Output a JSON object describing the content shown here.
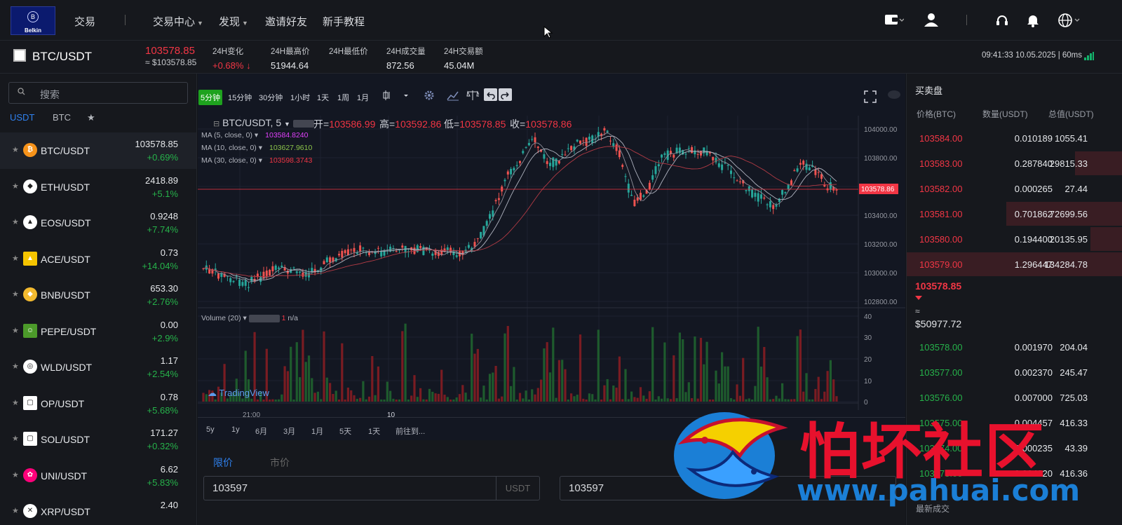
{
  "nav": {
    "logo_text": "Belkin",
    "trade": "交易",
    "items": [
      {
        "label": "交易中心",
        "dropdown": true
      },
      {
        "label": "发现",
        "dropdown": true
      },
      {
        "label": "邀请好友",
        "dropdown": false
      },
      {
        "label": "新手教程",
        "dropdown": false
      }
    ],
    "icons": [
      "wallet-icon",
      "user-icon",
      "headset-icon",
      "bell-icon",
      "globe-icon"
    ]
  },
  "ticker": {
    "pair": "BTC/USDT",
    "last": "103578.85",
    "last_usd": "≈ $103578.85",
    "change_label": "24H变化",
    "change": "+0.68% ↓",
    "high_label": "24H最高价",
    "high": "51944.64",
    "low_label": "24H最低价",
    "low": "",
    "vol_label": "24H成交量",
    "vol": "872.56",
    "amount_label": "24H交易额",
    "amount": "45.04M",
    "clock": "09:41:33 10.05.2025 | 60ms"
  },
  "market": {
    "search_placeholder": "搜索",
    "tabs": [
      "USDT",
      "BTC",
      "★"
    ],
    "rows": [
      {
        "pair": "BTC/USDT",
        "price": "103578.85",
        "change": "+0.69%",
        "icon": "btc-icon",
        "color": "#f7931a",
        "glyph": "₿"
      },
      {
        "pair": "ETH/USDT",
        "price": "2418.89",
        "change": "+5.1%",
        "icon": "eth-icon",
        "color": "#ffffff",
        "glyph": "◆"
      },
      {
        "pair": "EOS/USDT",
        "price": "0.9248",
        "change": "+7.74%",
        "icon": "eos-icon",
        "color": "#ffffff",
        "glyph": "▲"
      },
      {
        "pair": "ACE/USDT",
        "price": "0.73",
        "change": "+14.04%",
        "icon": "ace-icon",
        "color": "#f5c400",
        "glyph": "▲"
      },
      {
        "pair": "BNB/USDT",
        "price": "653.30",
        "change": "+2.76%",
        "icon": "bnb-icon",
        "color": "#f3ba2f",
        "glyph": "◆"
      },
      {
        "pair": "PEPE/USDT",
        "price": "0.00",
        "change": "+2.9%",
        "icon": "pepe-icon",
        "color": "#4c9a2a",
        "glyph": "☺"
      },
      {
        "pair": "WLD/USDT",
        "price": "1.17",
        "change": "+2.54%",
        "icon": "wld-icon",
        "color": "#ffffff",
        "glyph": "◎"
      },
      {
        "pair": "OP/USDT",
        "price": "0.78",
        "change": "+5.68%",
        "icon": "op-icon",
        "color": "#dddddd",
        "glyph": "▢"
      },
      {
        "pair": "SOL/USDT",
        "price": "171.27",
        "change": "+0.32%",
        "icon": "sol-icon",
        "color": "#dddddd",
        "glyph": "▢"
      },
      {
        "pair": "UNI/USDT",
        "price": "6.62",
        "change": "+5.83%",
        "icon": "uni-icon",
        "color": "#ff007a",
        "glyph": "✿"
      },
      {
        "pair": "XRP/USDT",
        "price": "2.40",
        "change": "",
        "icon": "xrp-icon",
        "color": "#ffffff",
        "glyph": "✕"
      }
    ]
  },
  "chart": {
    "timeframes": [
      "5分钟",
      "15分钟",
      "30分钟",
      "1小时",
      "1天",
      "1周",
      "1月"
    ],
    "active_tf": "5分钟",
    "title": "BTC/USDT, 5",
    "ohlc": {
      "o_label": "开=",
      "o": "103586.99",
      "h_label": "高=",
      "h": "103592.86",
      "l_label": "低=",
      "l": "103578.85",
      "c_label": "收=",
      "c": "103578.86"
    },
    "ma": [
      {
        "label": "MA (5, close, 0)",
        "value": "103584.8240",
        "color": "#e040fb"
      },
      {
        "label": "MA (10, close, 0)",
        "value": "103627.9610",
        "color": "#8bc34a"
      },
      {
        "label": "MA (30, close, 0)",
        "value": "103598.3743",
        "color": "#f23645"
      }
    ],
    "price_ticks": [
      "104000.00",
      "103800.00",
      "103600.00",
      "103400.00",
      "103200.00",
      "103000.00",
      "102800.00"
    ],
    "price_tag": "103578.86",
    "volume_label": "Volume (20)",
    "volume_value": "n/a",
    "volume_one": "1",
    "volume_ticks": [
      "40",
      "30",
      "20",
      "10",
      "0"
    ],
    "time_ticks": [
      "21:00",
      "10"
    ],
    "tv_logo": "TradingView",
    "ranges": [
      "5y",
      "1y",
      "6月",
      "3月",
      "1月",
      "5天",
      "1天",
      "前往到..."
    ],
    "colors": {
      "up": "#26a69a",
      "down": "#ef5350"
    }
  },
  "order": {
    "tab_limit": "限价",
    "tab_market": "市价",
    "price1": "103597",
    "unit1": "USDT",
    "price2": "103597"
  },
  "book": {
    "title": "买卖盘",
    "col_price": "价格(BTC)",
    "col_qty": "数量(USDT)",
    "col_total": "总值(USDT)",
    "asks": [
      {
        "price": "103584.00",
        "qty": "0.010189",
        "total": "1055.41",
        "depth": 0.0
      },
      {
        "price": "103583.00",
        "qty": "0.287840",
        "total": "29815.33",
        "depth": 0.22
      },
      {
        "price": "103582.00",
        "qty": "0.000265",
        "total": "27.44",
        "depth": 0.0
      },
      {
        "price": "103581.00",
        "qty": "0.701862",
        "total": "72699.56",
        "depth": 0.54
      },
      {
        "price": "103580.00",
        "qty": "0.194400",
        "total": "20135.95",
        "depth": 0.15
      },
      {
        "price": "103579.00",
        "qty": "1.296447",
        "total": "134284.78",
        "depth": 1.0
      }
    ],
    "mid": "103578.85",
    "mid_approx": "≈",
    "mid_usd": "$50977.72",
    "bids": [
      {
        "price": "103578.00",
        "qty": "0.001970",
        "total": "204.04"
      },
      {
        "price": "103577.00",
        "qty": "0.002370",
        "total": "245.47"
      },
      {
        "price": "103576.00",
        "qty": "0.007000",
        "total": "725.03"
      },
      {
        "price": "103575.00",
        "qty": "0.004457",
        "total": "416.33"
      },
      {
        "price": "103574.00",
        "qty": "0.000235",
        "total": "43.39"
      },
      {
        "price": "103573.00",
        "qty": "0.004020",
        "total": "416.36"
      }
    ],
    "latest_trades": "最新成交"
  },
  "watermark": {
    "title": "怕坏社区",
    "url": "www.pahuai.com"
  }
}
